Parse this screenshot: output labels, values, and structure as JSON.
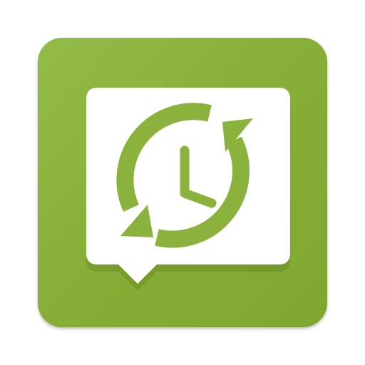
{
  "app": {
    "icon_name": "sms-backup-restore-app-icon",
    "colors": {
      "background": "#ffffff",
      "tile": "#8ab23c",
      "tile_dark": "#7fa72f",
      "bubble": "#ffffff",
      "glyph": "#8ab23c",
      "bubble_shadow": "#6f9228"
    },
    "glyph_icons": [
      "speech-bubble-icon",
      "circular-arrows-icon",
      "clock-icon"
    ]
  }
}
